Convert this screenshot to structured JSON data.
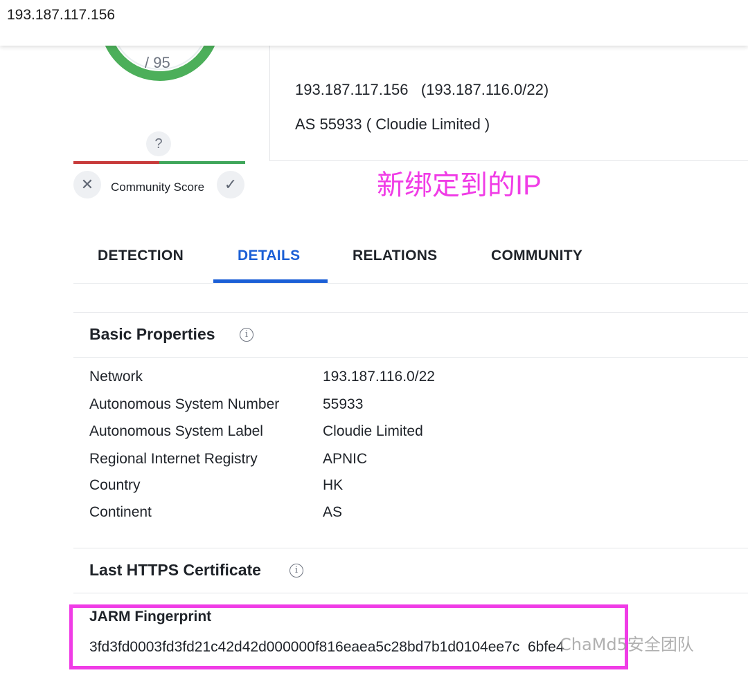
{
  "search": {
    "query": "193.187.117.156"
  },
  "score": {
    "denominator": "/ 95",
    "unknown_mark": "?",
    "community_label": "Community Score",
    "dismiss_glyph": "✕",
    "confirm_glyph": "✓"
  },
  "summary": {
    "ip_line": "193.187.117.156   (193.187.116.0/22)",
    "as_line": "AS 55933 ( Cloudie Limited )"
  },
  "annotation": {
    "text": "新绑定到的IP",
    "color": "#f03ce6"
  },
  "tabs": [
    {
      "label": "DETECTION"
    },
    {
      "label": "DETAILS"
    },
    {
      "label": "RELATIONS"
    },
    {
      "label": "COMMUNITY"
    }
  ],
  "active_tab": "DETAILS",
  "basic_properties": {
    "title": "Basic Properties",
    "rows": [
      {
        "key": "Network",
        "value": "193.187.116.0/22"
      },
      {
        "key": "Autonomous System Number",
        "value": "55933"
      },
      {
        "key": "Autonomous System Label",
        "value": "Cloudie Limited"
      },
      {
        "key": "Regional Internet Registry",
        "value": "APNIC"
      },
      {
        "key": "Country",
        "value": "HK"
      },
      {
        "key": "Continent",
        "value": "AS"
      }
    ]
  },
  "https_cert": {
    "title": "Last HTTPS Certificate",
    "jarm_title": "JARM Fingerprint",
    "jarm_value": "3fd3fd0003fd3fd21c42d42d000000f816eaea5c28bd7b1d0104ee7c  6bfe4"
  },
  "watermark": {
    "text": "ChaMd5安全团队"
  },
  "colors": {
    "accent": "#1b5fd6",
    "ring": "#4caf5a",
    "highlight": "#f03ce6"
  }
}
